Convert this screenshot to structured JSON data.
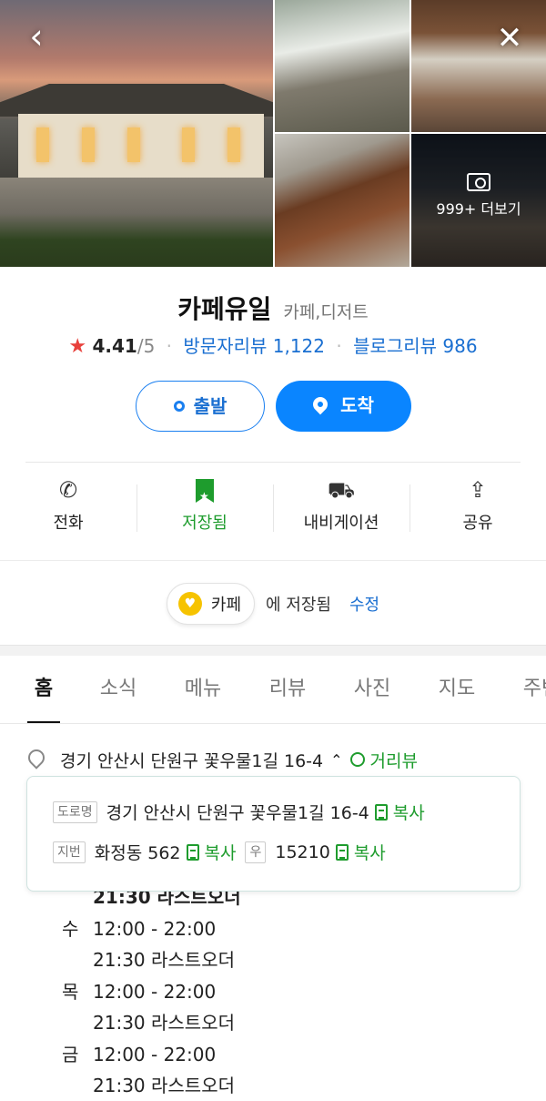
{
  "photos": {
    "more_label": "999+ 더보기"
  },
  "place": {
    "name": "카페유일",
    "category": "카페,디저트",
    "star": "★",
    "rating": "4.41",
    "rating_max": "/5",
    "visitor_reviews": "방문자리뷰 1,122",
    "blog_reviews": "블로그리뷰 986"
  },
  "route": {
    "start_label": "출발",
    "arrive_label": "도착"
  },
  "actions": [
    {
      "label": "전화",
      "icon": "phone-icon"
    },
    {
      "label": "저장됨",
      "icon": "bookmark-icon"
    },
    {
      "label": "내비게이션",
      "icon": "car-icon"
    },
    {
      "label": "공유",
      "icon": "share-icon"
    }
  ],
  "saved": {
    "folder": "카페",
    "text": "에 저장됨",
    "edit": "수정"
  },
  "tabs": [
    "홈",
    "소식",
    "메뉴",
    "리뷰",
    "사진",
    "지도",
    "주변"
  ],
  "address": {
    "main": "경기 안산시 단원구 꽃우물1길 16-4",
    "street_view": "거리뷰"
  },
  "popup": {
    "road_tag": "도로명",
    "road_addr": "경기 안산시 단원구 꽃우물1길 16-4",
    "copy": "복사",
    "lot_tag": "지번",
    "lot_addr": "화정동 562",
    "zip_tag": "우",
    "zip": "15210"
  },
  "hours": [
    {
      "day": "",
      "text": "21:30 라스트오더"
    },
    {
      "day": "수",
      "text": "12:00 - 22:00"
    },
    {
      "day": "",
      "text": "21:30 라스트오더"
    },
    {
      "day": "목",
      "text": "12:00 - 22:00"
    },
    {
      "day": "",
      "text": "21:30 라스트오더"
    },
    {
      "day": "금",
      "text": "12:00 - 22:00"
    },
    {
      "day": "",
      "text": "21:30 라스트오더"
    }
  ],
  "colors": {
    "accent_blue": "#0a85ff",
    "link_blue": "#1a6fd1",
    "saved_green": "#1e9c2d",
    "star_red": "#e8403b"
  }
}
